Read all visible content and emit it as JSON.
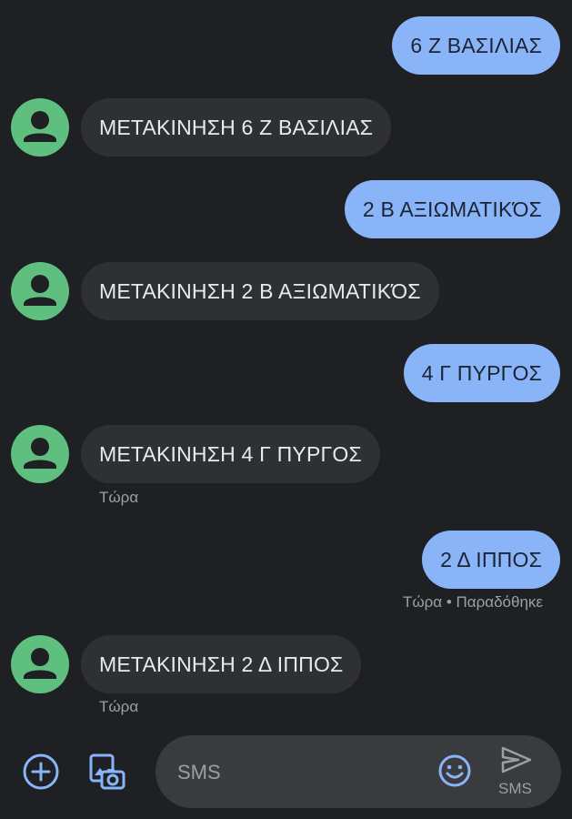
{
  "colors": {
    "background": "#1f2023",
    "outgoing_bubble": "#8ab4f8",
    "incoming_bubble": "#2f3033",
    "avatar": "#5fbf7f",
    "accent_icon": "#8ab4f8"
  },
  "messages": [
    {
      "direction": "out",
      "text": "6 Ζ ΒΑΣΙΛΙΑΣ"
    },
    {
      "direction": "in",
      "text": "ΜΕΤΑΚΙΝΗΣΗ 6 Ζ ΒΑΣΙΛΙΑΣ"
    },
    {
      "direction": "out",
      "text": "2 Β ΑΞΙΩΜΑΤΙΚΌΣ"
    },
    {
      "direction": "in",
      "text": "ΜΕΤΑΚΙΝΗΣΗ 2 Β ΑΞΙΩΜΑΤΙΚΌΣ"
    },
    {
      "direction": "out",
      "text": "4 Γ ΠΥΡΓΟΣ"
    },
    {
      "direction": "in",
      "text": "ΜΕΤΑΚΙΝΗΣΗ 4 Γ ΠΥΡΓΟΣ",
      "meta": "Τώρα"
    },
    {
      "direction": "out",
      "text": "2 Δ ΙΠΠΟΣ",
      "meta": "Τώρα • Παραδόθηκε"
    },
    {
      "direction": "in",
      "text": "ΜΕΤΑΚΙΝΗΣΗ 2 Δ ΙΠΠΟΣ",
      "meta": "Τώρα"
    }
  ],
  "composer": {
    "placeholder": "SMS",
    "send_label": "SMS",
    "icons": {
      "add": "plus-circle-icon",
      "gallery": "gallery-camera-icon",
      "emoji": "emoji-icon",
      "send": "send-icon"
    }
  }
}
